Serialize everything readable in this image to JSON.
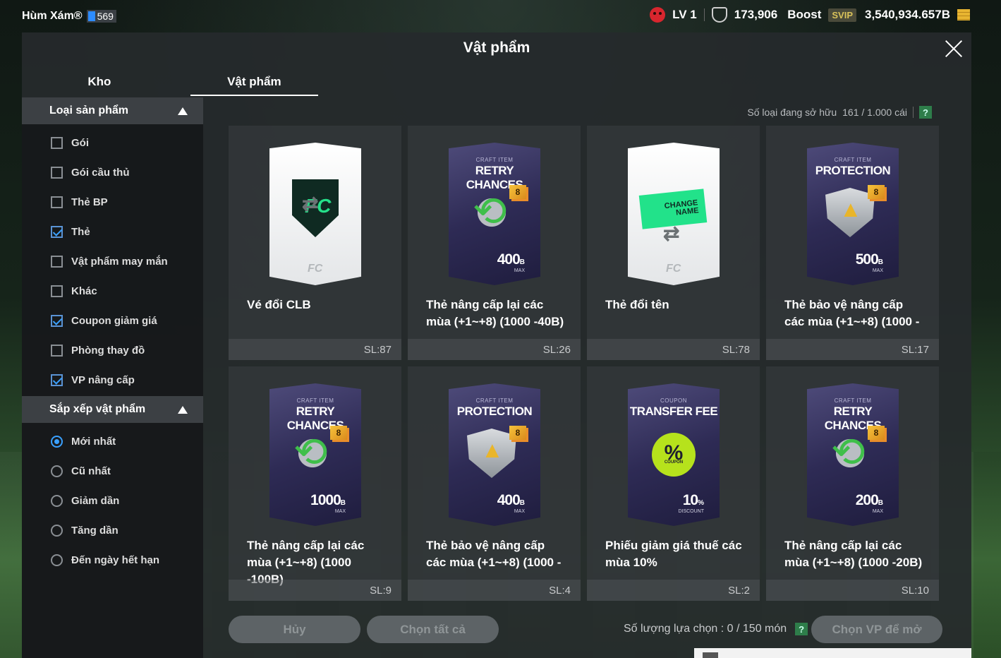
{
  "topbar": {
    "username": "Hùm Xám®",
    "user_badge": "569",
    "level": "LV 1",
    "points": "173,906",
    "boost_label": "Boost",
    "svip_label": "SVIP",
    "coins": "3,540,934.657B"
  },
  "modal": {
    "title": "Vật phẩm"
  },
  "tabs": [
    {
      "label": "Kho"
    },
    {
      "label": "Vật phẩm"
    }
  ],
  "sidebar": {
    "section1": {
      "title": "Loại sản phẩm",
      "options": [
        {
          "label": "Gói",
          "checked": false
        },
        {
          "label": "Gói cầu thủ",
          "checked": false
        },
        {
          "label": "Thẻ BP",
          "checked": false
        },
        {
          "label": "Thẻ",
          "checked": true
        },
        {
          "label": "Vật phẩm may mắn",
          "checked": false
        },
        {
          "label": "Khác",
          "checked": false
        },
        {
          "label": "Coupon giảm giá",
          "checked": true
        },
        {
          "label": "Phòng thay đồ",
          "checked": false
        },
        {
          "label": "VP nâng cấp",
          "checked": true
        }
      ]
    },
    "section2": {
      "title": "Sắp xếp vật phẩm",
      "options": [
        {
          "label": "Mới nhất",
          "selected": true
        },
        {
          "label": "Cũ nhất",
          "selected": false
        },
        {
          "label": "Giảm dần",
          "selected": false
        },
        {
          "label": "Tăng dần",
          "selected": false
        },
        {
          "label": "Đến ngày hết hạn",
          "selected": false
        }
      ]
    }
  },
  "owned": {
    "label": "Số loại đang sở hữu",
    "value": "161 / 1.000 cái",
    "help": "?"
  },
  "items": [
    {
      "name": "Vé đổi CLB",
      "qty": "SL:87"
    },
    {
      "name": "Thẻ nâng cấp lại các mùa (+1~+8) (1000 -40B)",
      "qty": "SL:26",
      "sub": "CRAFT ITEM",
      "title": "RETRY CHANCES",
      "level": "8",
      "value": "400",
      "unit": "B",
      "max": "MAX"
    },
    {
      "name": "Thẻ đổi tên",
      "qty": "SL:78",
      "tag": "CHANGE NAME"
    },
    {
      "name": "Thẻ bảo vệ nâng cấp các mùa (+1~+8) (1000 -",
      "qty": "SL:17",
      "sub": "CRAFT ITEM",
      "title": "PROTECTION",
      "level": "8",
      "value": "500",
      "unit": "B",
      "max": "MAX"
    },
    {
      "name": "Thẻ nâng cấp lại các mùa (+1~+8) (1000 -100B)",
      "qty": "SL:9",
      "sub": "CRAFT ITEM",
      "title": "RETRY CHANCES",
      "level": "8",
      "value": "1000",
      "unit": "B",
      "max": "MAX"
    },
    {
      "name": "Thẻ bảo vệ nâng cấp các mùa (+1~+8) (1000 -",
      "qty": "SL:4",
      "sub": "CRAFT ITEM",
      "title": "PROTECTION",
      "level": "8",
      "value": "400",
      "unit": "B",
      "max": "MAX"
    },
    {
      "name": "Phiếu giảm giá thuế các mùa 10%",
      "qty": "SL:2",
      "sub": "COUPON",
      "title": "TRANSFER FEE",
      "pct": "%",
      "pct_sub": "COUPON",
      "value": "10",
      "unit": "%",
      "max": "DISCOUNT"
    },
    {
      "name": "Thẻ nâng cấp lại các mùa (+1~+8) (1000 -20B)",
      "qty": "SL:10",
      "sub": "CRAFT ITEM",
      "title": "RETRY CHANCES",
      "level": "8",
      "value": "200",
      "unit": "B",
      "max": "MAX"
    }
  ],
  "footer": {
    "cancel": "Hủy",
    "select_all": "Chọn tất cả",
    "selected_count": "Số lượng lựa chọn : 0 / 150 món",
    "help": "?",
    "open": "Chọn VP để mở"
  },
  "colors": {
    "accent": "#3aa0ff",
    "green": "#22e28a",
    "panel": "#262a2c"
  }
}
